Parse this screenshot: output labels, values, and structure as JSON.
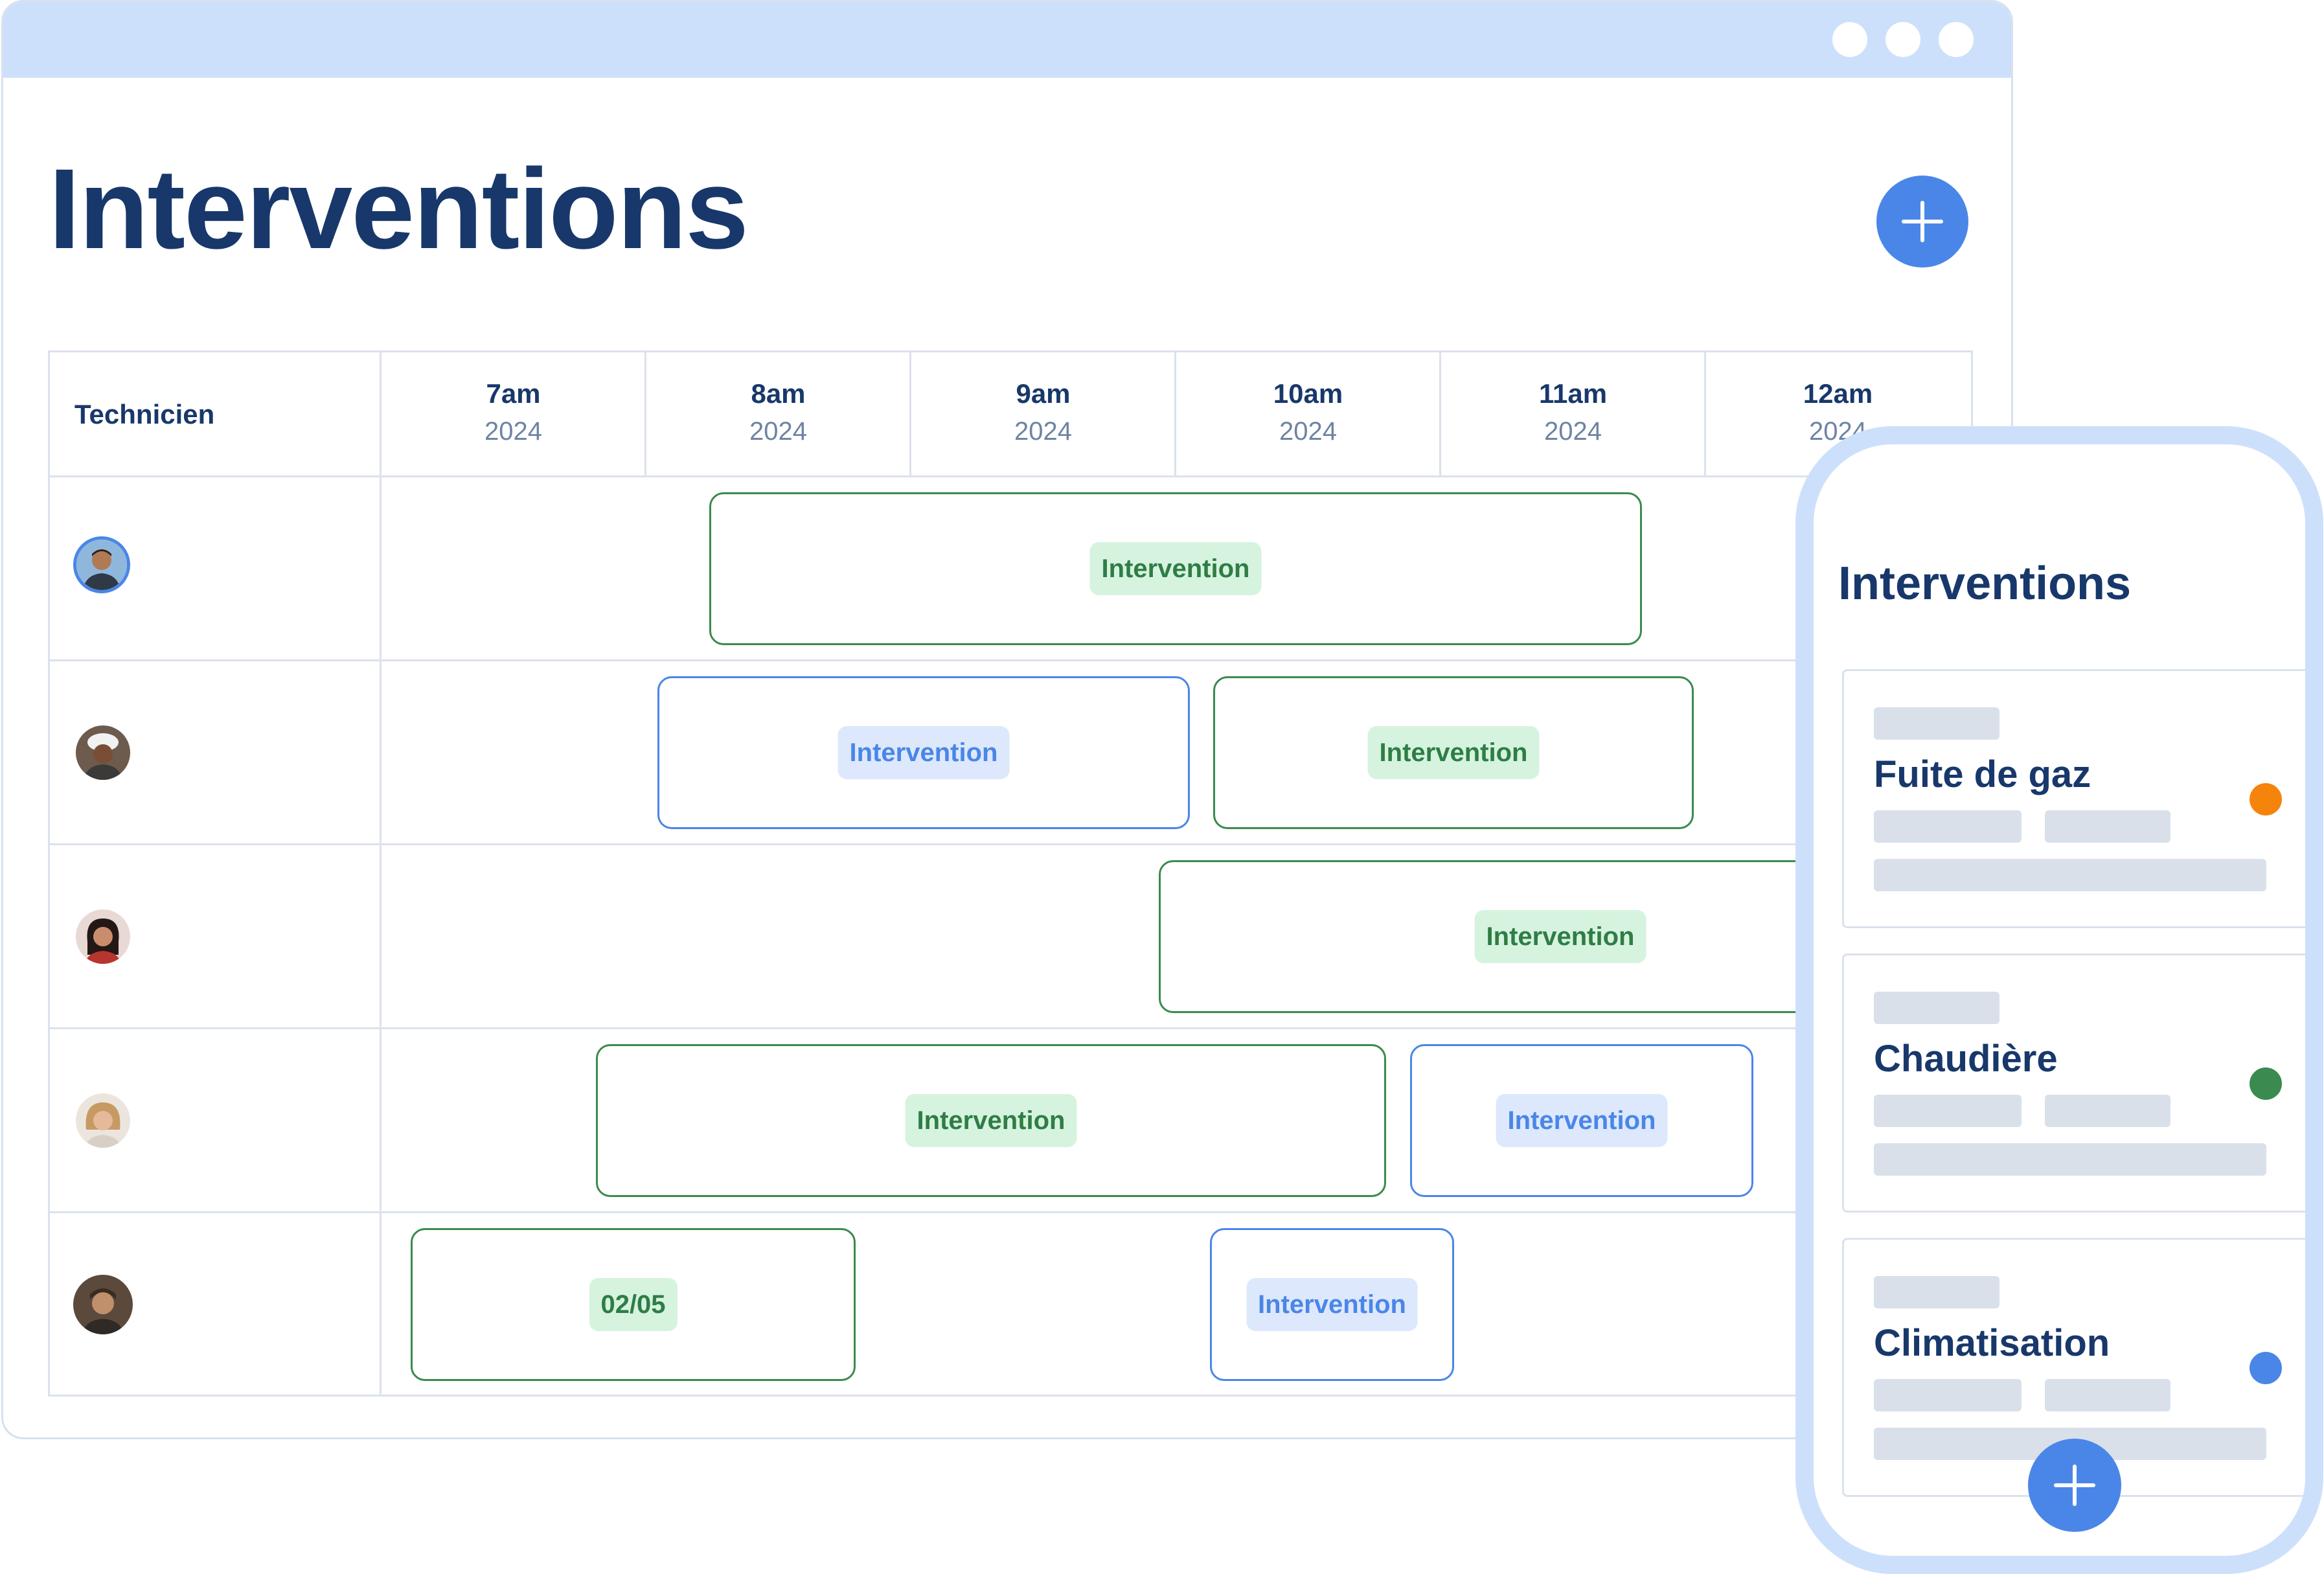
{
  "desktop": {
    "title": "Interventions",
    "add_button_icon": "plus-icon",
    "window_dots": 3,
    "grid": {
      "technician_header": "Technicien",
      "hours": [
        {
          "hour": "7am",
          "year": "2024"
        },
        {
          "hour": "8am",
          "year": "2024"
        },
        {
          "hour": "9am",
          "year": "2024"
        },
        {
          "hour": "10am",
          "year": "2024"
        },
        {
          "hour": "11am",
          "year": "2024"
        },
        {
          "hour": "12am",
          "year": "2024"
        }
      ],
      "rows": [
        {
          "technician": "technician-1",
          "events": [
            {
              "label": "Intervention",
              "status": "green"
            }
          ]
        },
        {
          "technician": "technician-2",
          "events": [
            {
              "label": "Intervention",
              "status": "blue"
            },
            {
              "label": "Intervention",
              "status": "green"
            }
          ]
        },
        {
          "technician": "technician-3",
          "events": [
            {
              "label": "Intervention",
              "status": "green"
            }
          ]
        },
        {
          "technician": "technician-4",
          "events": [
            {
              "label": "Intervention",
              "status": "green"
            },
            {
              "label": "Intervention",
              "status": "blue"
            }
          ]
        },
        {
          "technician": "technician-5",
          "events": [
            {
              "label": "02/05",
              "status": "green"
            },
            {
              "label": "Intervention",
              "status": "blue"
            }
          ]
        }
      ]
    }
  },
  "mobile": {
    "title": "Interventions",
    "cards": [
      {
        "title": "Fuite de gaz",
        "dot_color": "#f5840c"
      },
      {
        "title": "Chaudière",
        "dot_color": "#3b8a4f"
      },
      {
        "title": "Climatisation",
        "dot_color": "#4a86e8"
      }
    ],
    "add_button_icon": "plus-icon"
  },
  "colors": {
    "brand_dark": "#18386b",
    "accent_blue": "#4a86e8",
    "green": "#3b8a4f",
    "titlebar": "#cde0fb"
  }
}
